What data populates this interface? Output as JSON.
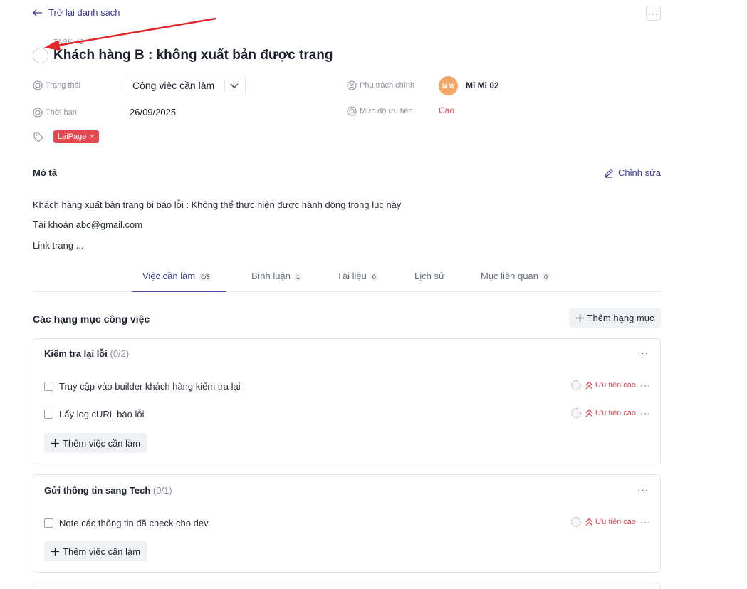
{
  "back": {
    "label": "Trở lại danh sách"
  },
  "top_more": {
    "label": "···"
  },
  "task": {
    "id": "TASK-42",
    "title": "Khách hàng B : không xuất bản được trang"
  },
  "properties": {
    "status_label": "Trạng thái",
    "status_value": "Công việc cần làm",
    "due_label": "Thời hạn",
    "due_value": "26/09/2025",
    "assignee_label": "Phụ trách chính",
    "assignee_initials": "MM",
    "assignee_name": "Mi Mi 02",
    "priority_label": "Mức độ ưu tiên",
    "priority_value": "Cao",
    "tag": "LaiPage",
    "tag_remove": "×"
  },
  "description": {
    "title": "Mô tả",
    "edit_label": "Chỉnh sửa",
    "lines": [
      "Khách hàng xuất bản trang bị báo lỗi : Không thể thực hiện được hành động trong lúc này",
      "Tài khoản abc@gmail.com",
      "Link trang ..."
    ]
  },
  "tabs": [
    {
      "label": "Việc cần làm",
      "badge": "0/5"
    },
    {
      "label": "Bình luận",
      "badge": "1"
    },
    {
      "label": "Tài liệu",
      "badge": "0"
    },
    {
      "label": "Lịch sử",
      "badge": ""
    },
    {
      "label": "Mục liên quan",
      "badge": "0"
    }
  ],
  "work": {
    "title": "Các hạng mục công việc",
    "add_section_label": "Thêm hạng mục",
    "add_task_label": "Thêm việc cần làm",
    "item_more": "···",
    "sections": [
      {
        "title": "Kiểm tra lại lỗi",
        "count": "(0/2)",
        "items": [
          {
            "text": "Truy cập vào builder khách hàng kiểm tra lại",
            "priority": "Ưu tiên cao"
          },
          {
            "text": "Lấy log cURL báo lỗi",
            "priority": "Ưu tiên cao"
          }
        ]
      },
      {
        "title": "Gửi thông tin sang Tech",
        "count": "(0/1)",
        "items": [
          {
            "text": "Note các thông tin đã check cho dev",
            "priority": "Ưu tiên cao"
          }
        ]
      }
    ]
  },
  "colors": {
    "accent": "#3b3a9a",
    "priority": "#d64550",
    "tag": "#e5484d",
    "avatar": "#f2a766",
    "annotation_arrow": "#e3262b"
  }
}
